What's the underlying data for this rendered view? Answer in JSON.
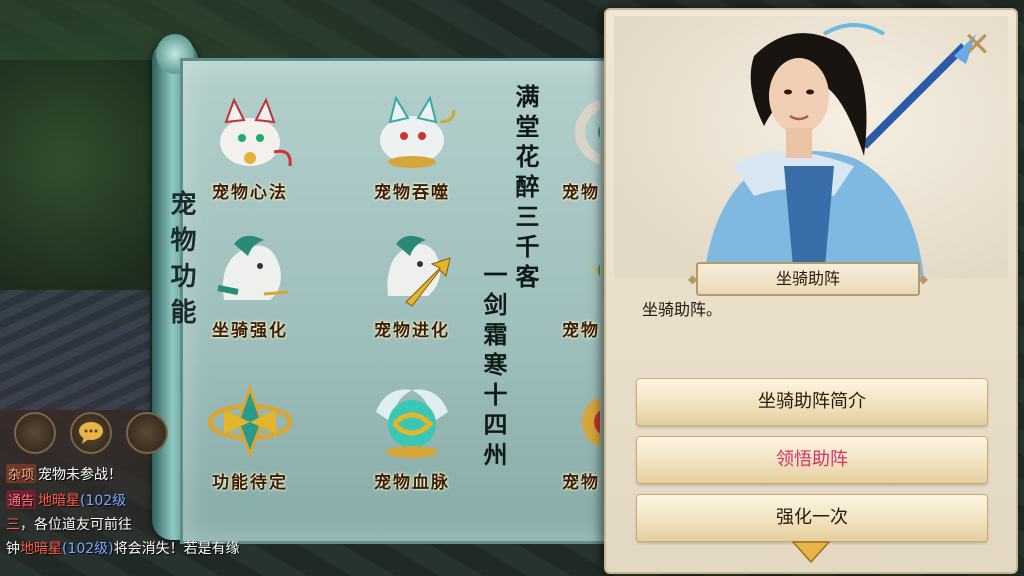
{
  "pet_panel": {
    "title": "宠物功能",
    "items": [
      {
        "label": "宠物心法",
        "icon": "white-cat-pet-icon"
      },
      {
        "label": "宠物吞噬",
        "icon": "white-fox-pet-icon"
      },
      {
        "label": "坐骑强化",
        "icon": "white-horse-mount-icon"
      },
      {
        "label": "宠物进化",
        "icon": "horse-evolve-arrow-icon"
      },
      {
        "label": "功能待定",
        "icon": "gold-crest-emblem-icon"
      },
      {
        "label": "宠物血脉",
        "icon": "cyan-orb-bloodline-icon"
      }
    ],
    "partial_label": "宠物",
    "poem_right": "满堂花醉三千客",
    "poem_left": "一剑霜寒十四州"
  },
  "chat": {
    "lines": [
      {
        "tag": "杂项",
        "text": "宠物未参战！"
      },
      {
        "tag": "通告",
        "text": "地暗星",
        "level": "(102级"
      },
      {
        "prefix": "三",
        "text": "，各位道友可前往"
      },
      {
        "text": "钟",
        "name": "地暗星",
        "level": "(102级)",
        "rest": "将会消失！若是有缘"
      }
    ],
    "buttons": [
      "avatar-chat-icon",
      "speech-bubble-icon",
      "microphone-icon"
    ]
  },
  "dialog": {
    "npc_name": "坐骑助阵",
    "description": "坐骑助阵。",
    "options": [
      {
        "label": "坐骑助阵简介"
      },
      {
        "label": "领悟助阵",
        "color": "#d4336a"
      },
      {
        "label": "强化一次"
      }
    ],
    "close_icon": "close-x-icon",
    "more_icon": "chevron-down-icon"
  }
}
